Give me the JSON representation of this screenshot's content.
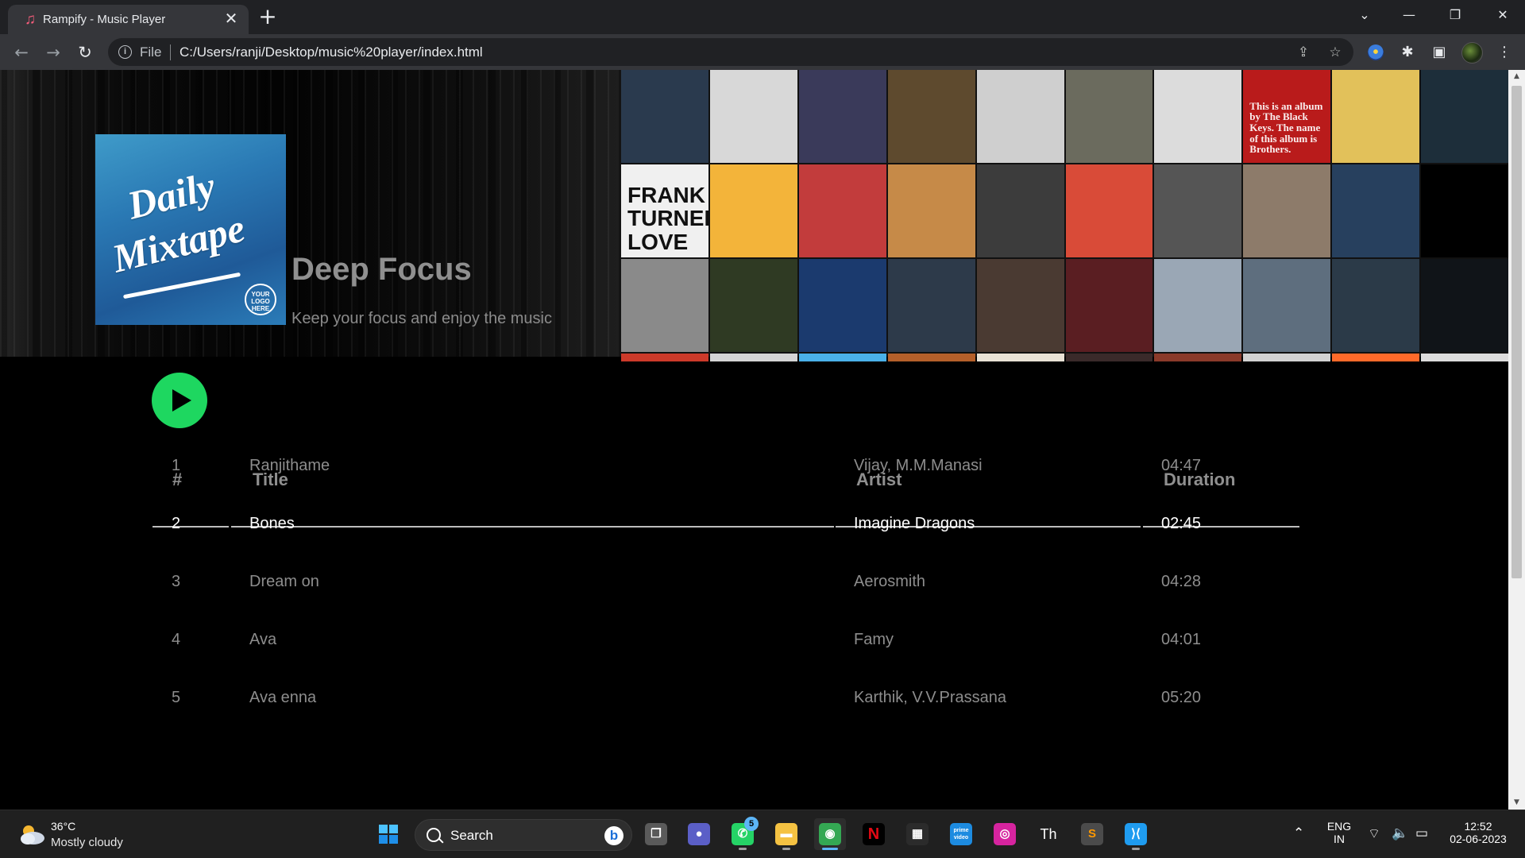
{
  "browser": {
    "tab_title": "Rampify - Music Player",
    "tab_close": "✕",
    "new_tab": "+",
    "file_label": "File",
    "url": "C:/Users/ranji/Desktop/music%20player/index.html",
    "window_controls": {
      "dropdown": "⌄",
      "minimize": "—",
      "restore": "❐",
      "close": "✕"
    },
    "nav": {
      "back": "←",
      "forward": "→",
      "reload": "↻"
    },
    "toolbar_icons": {
      "share": "⇪",
      "bookmark": "☆",
      "extensions": "✱",
      "sidepanel": "▣",
      "menu": "⋮"
    }
  },
  "playlist": {
    "cover": {
      "line1": "Daily",
      "line2": "Mixtape",
      "badge": "YOUR LOGO HERE"
    },
    "title": "Deep Focus",
    "description": "Keep your focus and enjoy the music"
  },
  "album_tiles": [
    {
      "color": "#2a3a4e",
      "text": ""
    },
    {
      "color": "#d8d8d8",
      "text": ""
    },
    {
      "color": "#3a3a5a",
      "text": ""
    },
    {
      "color": "#5e4a2e",
      "text": ""
    },
    {
      "color": "#cfcfcf",
      "text": ""
    },
    {
      "color": "#6b6b5e",
      "text": ""
    },
    {
      "color": "#dcdcdc",
      "text": ""
    },
    {
      "color": "#b91b1b",
      "text": "This is an album by The Black Keys. The name of this album is Brothers."
    },
    {
      "color": "#e2c15a",
      "text": ""
    },
    {
      "color": "#1d2e3a",
      "text": ""
    },
    {
      "color": "#f0f0f0",
      "text": "FRANK TURNER LOVE IRE & SONG",
      "big": true
    },
    {
      "color": "#f3b43a",
      "text": ""
    },
    {
      "color": "#c23c3c",
      "text": ""
    },
    {
      "color": "#c68a48",
      "text": ""
    },
    {
      "color": "#3c3c3c",
      "text": ""
    },
    {
      "color": "#d94b38",
      "text": ""
    },
    {
      "color": "#555555",
      "text": ""
    },
    {
      "color": "#8d7b6a",
      "text": ""
    },
    {
      "color": "#27405e",
      "text": ""
    },
    {
      "color": "#000000",
      "text": ""
    },
    {
      "color": "#8a8a8a",
      "text": ""
    },
    {
      "color": "#2f3a23",
      "text": ""
    },
    {
      "color": "#1b3a6e",
      "text": ""
    },
    {
      "color": "#2d3a4a",
      "text": ""
    },
    {
      "color": "#4a3a32",
      "text": ""
    },
    {
      "color": "#5a1e22",
      "text": ""
    },
    {
      "color": "#9aa7b5",
      "text": ""
    },
    {
      "color": "#5e6e7e",
      "text": ""
    },
    {
      "color": "#2b3a48",
      "text": ""
    },
    {
      "color": "#101418",
      "text": ""
    },
    {
      "color": "#cc3a2a",
      "text": ""
    },
    {
      "color": "#d5d5d5",
      "text": ""
    },
    {
      "color": "#4ab0e8",
      "text": ""
    },
    {
      "color": "#b45f2a",
      "text": ""
    },
    {
      "color": "#e8e2d6",
      "text": ""
    },
    {
      "color": "#3a2a2a",
      "text": ""
    },
    {
      "color": "#8a3a2a",
      "text": ""
    },
    {
      "color": "#d2d2d2",
      "text": ""
    },
    {
      "color": "#ff6a2a",
      "text": ""
    },
    {
      "color": "#dcdcdc",
      "text": ""
    }
  ],
  "table": {
    "headers": {
      "num": "#",
      "title": "Title",
      "artist": "Artist",
      "duration": "Duration"
    },
    "rows": [
      {
        "num": "1",
        "title": "Ranjithame",
        "artist": "Vijay, M.M.Manasi",
        "duration": "04:47"
      },
      {
        "num": "2",
        "title": "Bones",
        "artist": "Imagine Dragons",
        "duration": "02:45"
      },
      {
        "num": "3",
        "title": "Dream on",
        "artist": "Aerosmith",
        "duration": "04:28"
      },
      {
        "num": "4",
        "title": "Ava",
        "artist": "Famy",
        "duration": "04:01"
      },
      {
        "num": "5",
        "title": "Ava enna",
        "artist": "Karthik, V.V.Prassana",
        "duration": "05:20"
      }
    ],
    "active_row": 2
  },
  "taskbar": {
    "weather": {
      "temp": "36°C",
      "desc": "Mostly cloudy"
    },
    "search_placeholder": "Search",
    "whatsapp_badge": "5",
    "lang": {
      "line1": "ENG",
      "line2": "IN"
    },
    "clock": {
      "time": "12:52",
      "date": "02-06-2023"
    },
    "apps": [
      {
        "name": "start-button",
        "color": "#1f8fe8",
        "glyph": "⊞"
      },
      {
        "name": "task-view-app",
        "color": "#5a5a5a",
        "glyph": "❐"
      },
      {
        "name": "teams-app",
        "color": "#5b5fc7",
        "glyph": "●"
      },
      {
        "name": "whatsapp-app",
        "color": "#25d366",
        "glyph": "✆"
      },
      {
        "name": "file-explorer-app",
        "color": "#f5c242",
        "glyph": "▬"
      },
      {
        "name": "chrome-app",
        "color": "#34a853",
        "glyph": "◉"
      },
      {
        "name": "netflix-app",
        "color": "#000000",
        "glyph": "N"
      },
      {
        "name": "ms-store-app",
        "color": "#2b2b2b",
        "glyph": "▦"
      },
      {
        "name": "prime-video-app",
        "color": "#1d8be0",
        "glyph": "prime video"
      },
      {
        "name": "instagram-app",
        "color": "#d6249f",
        "glyph": "◎"
      },
      {
        "name": "text-app",
        "color": "#202020",
        "glyph": "Th"
      },
      {
        "name": "sublime-app",
        "color": "#4b4b4b",
        "glyph": "S"
      },
      {
        "name": "vscode-app",
        "color": "#1f9cf0",
        "glyph": "⟩⟨"
      }
    ]
  },
  "colors": {
    "accent_green": "#1ed760",
    "active_row_text": "#ffffff",
    "inactive_text": "#8d8d8d"
  }
}
